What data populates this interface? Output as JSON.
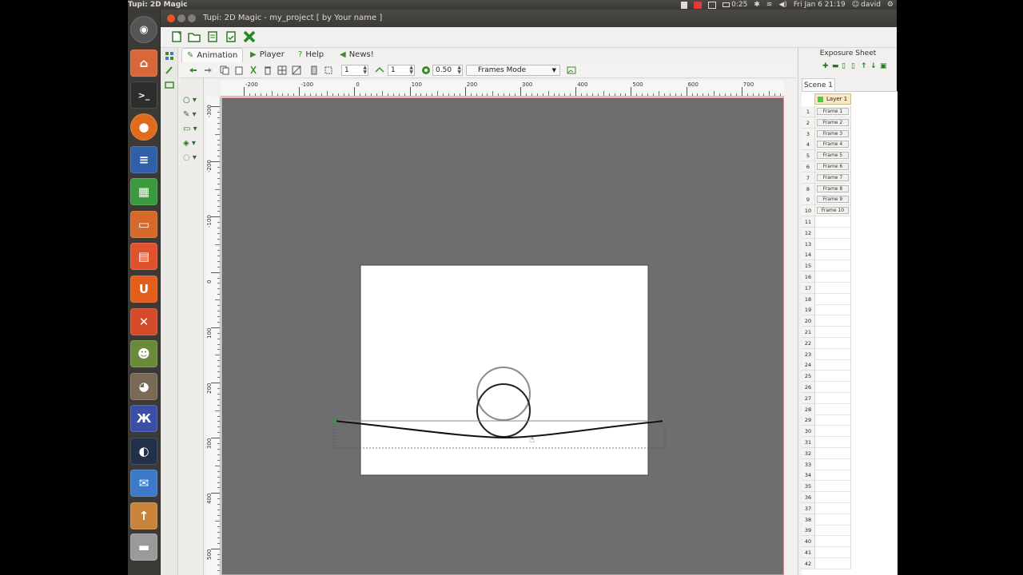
{
  "top_panel": {
    "app_name": "Tupi: 2D Magic",
    "battery": "0:25",
    "clock": "Fri Jan  6 21:19",
    "user": "david"
  },
  "window": {
    "title": "Tupi: 2D Magic - my_project [ by Your name ]"
  },
  "tabs": [
    {
      "label": "Animation",
      "icon": "animation-icon"
    },
    {
      "label": "Player",
      "icon": "play-icon"
    },
    {
      "label": "Help",
      "icon": "help-icon"
    },
    {
      "label": "News!",
      "icon": "news-icon"
    }
  ],
  "paint_toolbar": {
    "spin1": "1",
    "spin2": "1",
    "opacity": "0.50",
    "mode": "Frames Mode"
  },
  "hruler_labels": [
    "-200",
    "-100",
    "0",
    "100",
    "200",
    "300",
    "400",
    "500",
    "600",
    "700"
  ],
  "vruler_labels": [
    "-300",
    "-200",
    "-100",
    "0",
    "100",
    "200",
    "300",
    "400",
    "500"
  ],
  "exposure_sheet": {
    "title": "Exposure Sheet",
    "scene": "Scene 1",
    "layer": "Layer 1",
    "frames": [
      "Frame 1",
      "Frame 2",
      "Frame 3",
      "Frame 4",
      "Frame 5",
      "Frame 6",
      "Frame 7",
      "Frame 8",
      "Frame 9",
      "Frame 10"
    ],
    "row_count": 42
  },
  "colors": {
    "accent_green": "#3a8b2d",
    "canvas_bg": "#6e6e6e",
    "launcher_bg": "#3b3a36",
    "close_button": "#e9552a"
  }
}
